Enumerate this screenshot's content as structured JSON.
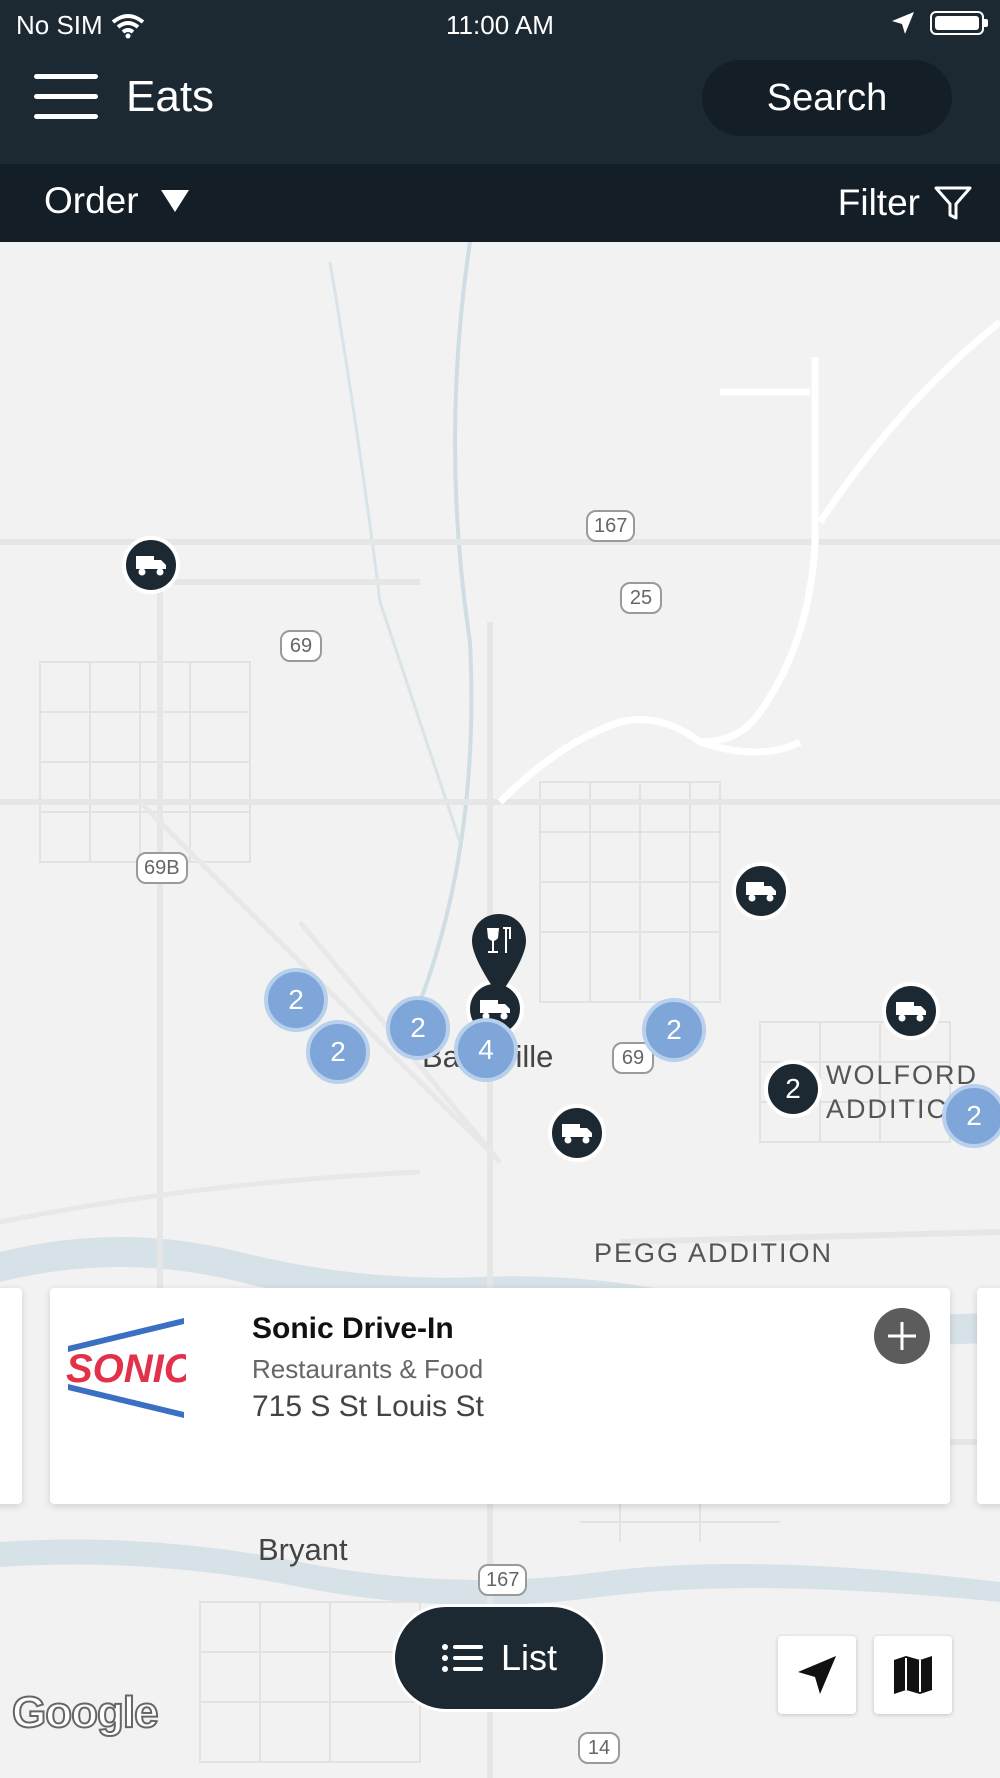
{
  "status_bar": {
    "carrier": "No SIM",
    "time": "11:00 AM"
  },
  "header": {
    "title": "Eats",
    "search_label": "Search"
  },
  "subbar": {
    "order_label": "Order",
    "filter_label": "Filter"
  },
  "map": {
    "route_shields": [
      "167",
      "25",
      "69",
      "69B",
      "69",
      "167",
      "14"
    ],
    "places": [
      "Ba",
      "ville",
      "WOLFORD",
      "ADDITIC",
      "PEGG ADDITION",
      "Bryant"
    ],
    "clusters": [
      "2",
      "2",
      "2",
      "4",
      "2",
      "2",
      "2"
    ],
    "attribution": "Google"
  },
  "card": {
    "name": "Sonic Drive-In",
    "category": "Restaurants & Food",
    "address": "715 S St Louis St",
    "logo_text": "SONIC"
  },
  "list_button_label": "List",
  "icons": [
    "wifi-icon",
    "location-arrow-icon",
    "battery-icon",
    "hamburger-menu-icon",
    "dropdown-triangle-icon",
    "filter-funnel-icon",
    "truck-icon",
    "restaurant-pin-icon",
    "plus-icon",
    "list-icon",
    "navigate-arrow-icon",
    "map-icon"
  ],
  "colors": {
    "header_bg": "#1d2932",
    "subbar_bg": "#141e26",
    "cluster": "#7ea6d9",
    "map_bg": "#f2f2f2"
  }
}
